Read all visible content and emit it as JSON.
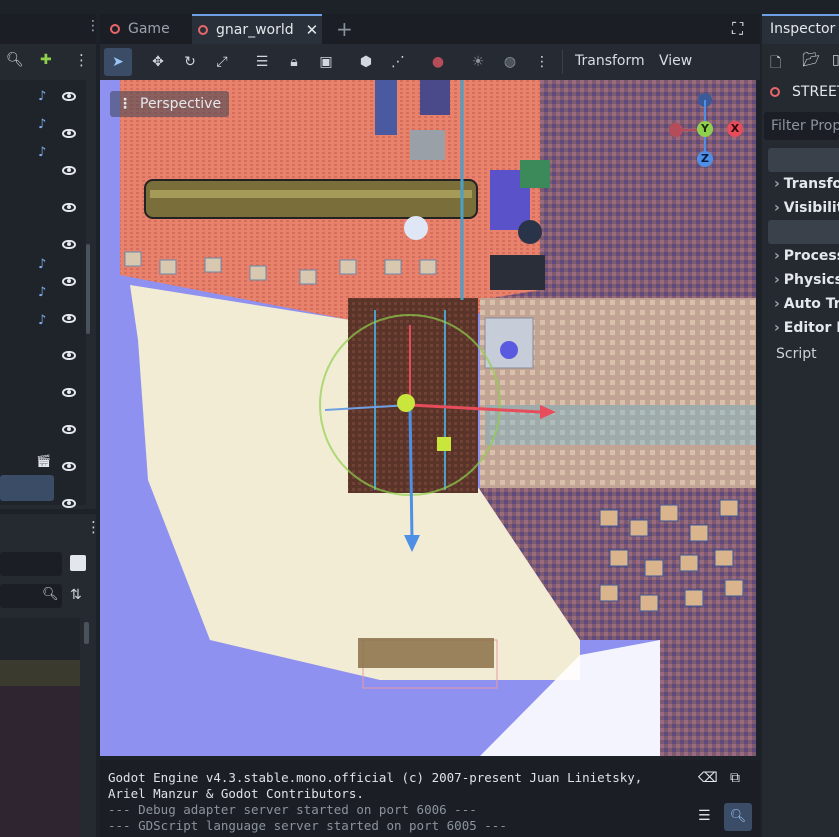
{
  "tabs": [
    {
      "label": "Game",
      "active": false
    },
    {
      "label": "gnar_world",
      "active": true
    }
  ],
  "viewport": {
    "perspective_label": "Perspective",
    "toolbar_menus": {
      "transform": "Transform",
      "view": "View"
    },
    "gizmo_axes": {
      "x": "X",
      "y": "Y",
      "z": "Z"
    }
  },
  "inspector": {
    "title": "Inspector",
    "node_name": "STREET",
    "filter_placeholder": "Filter Prop",
    "sections": [
      "Transfor",
      "Visibility",
      "Process",
      "Physics",
      "Auto Tra",
      "Editor D"
    ],
    "script_label": "Script"
  },
  "output": {
    "lines": [
      "Godot Engine v4.3.stable.mono.official (c) 2007-present Juan Linietsky,",
      "Ariel Manzur & Godot Contributors.",
      "--- Debug adapter server started on port 6006 ---",
      "--- GDScript language server started on port 6005 ---"
    ]
  },
  "colors": {
    "accent": "#6ea0e4",
    "x_axis": "#e74c5b",
    "y_axis": "#8fd04d",
    "z_axis": "#4e90e6",
    "sand": "#f3ecd4",
    "sky": "#8e91f0",
    "roof": "#e8826c"
  }
}
